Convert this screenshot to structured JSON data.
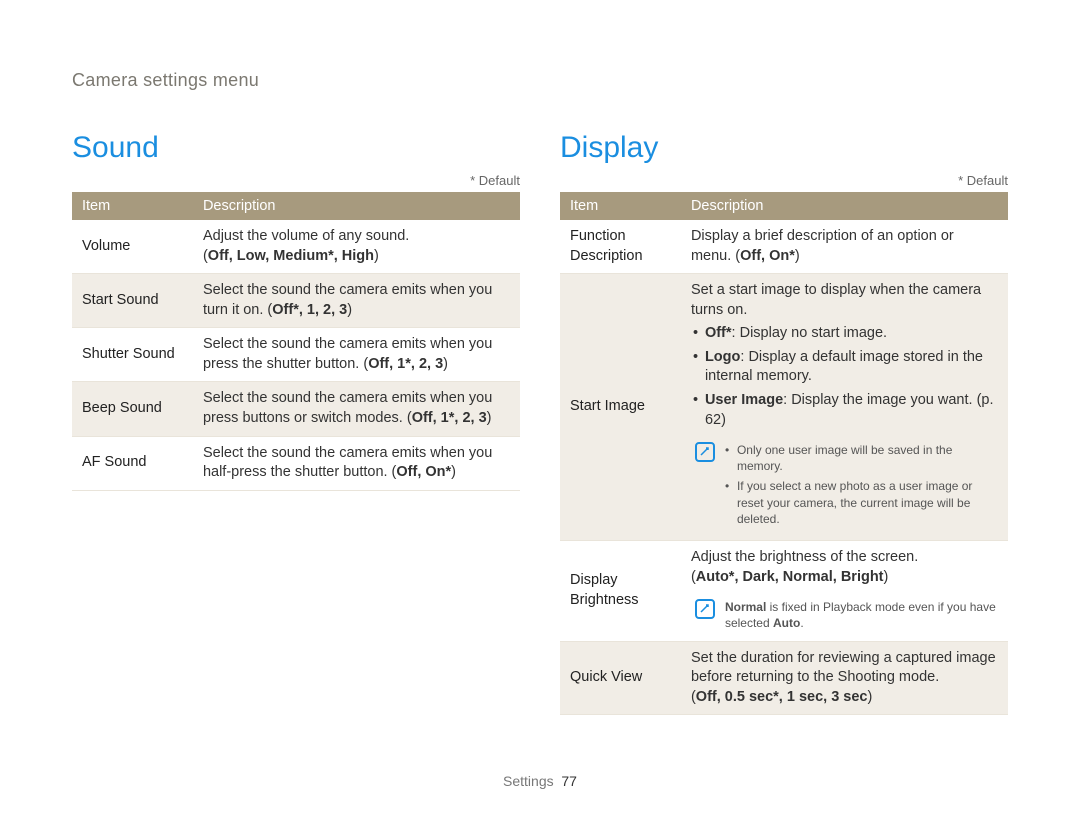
{
  "breadcrumb": "Camera settings menu",
  "default_label": "* Default",
  "footer": {
    "section": "Settings",
    "page": "77"
  },
  "left": {
    "title": "Sound",
    "headers": {
      "item": "Item",
      "desc": "Description"
    },
    "rows": [
      {
        "item": "Volume",
        "desc_pre": "Adjust the volume of any sound. ",
        "opts_open": "(",
        "opts": "Off, Low, Medium*, High",
        "opts_close": ")"
      },
      {
        "item": "Start Sound",
        "desc_pre": "Select the sound the camera emits when you turn it on. (",
        "opts": "Off*, 1, 2, 3",
        "opts_close": ")"
      },
      {
        "item": "Shutter Sound",
        "desc_pre": "Select the sound the camera emits when you press the shutter button. (",
        "opts": "Off, 1*, 2, 3",
        "opts_close": ")"
      },
      {
        "item": "Beep Sound",
        "desc_pre": "Select the sound the camera emits when you press buttons or switch modes. (",
        "opts": "Off, 1*, 2, 3",
        "opts_close": ")"
      },
      {
        "item": "AF Sound",
        "desc_pre": "Select the sound the camera emits when you half-press the shutter button. (",
        "opts": "Off, On*",
        "opts_close": ")"
      }
    ]
  },
  "right": {
    "title": "Display",
    "headers": {
      "item": "Item",
      "desc": "Description"
    },
    "rows": {
      "func_desc": {
        "item": "Function Description",
        "desc_pre": "Display a brief description of an option or menu. (",
        "opts": "Off, On*",
        "opts_close": ")"
      },
      "start_image": {
        "item": "Start Image",
        "intro": "Set a start image to display when the camera turns on.",
        "bullets": [
          {
            "label": "Off*",
            "text": ": Display no start image."
          },
          {
            "label": "Logo",
            "text": ": Display a default image stored in the internal memory."
          },
          {
            "label": "User Image",
            "text": ": Display the image you want. (p. 62)"
          }
        ],
        "notes": [
          "Only one user image will be saved in the memory.",
          "If you select a new photo as a user image or reset your camera, the current image will be deleted."
        ]
      },
      "brightness": {
        "item": "Display Brightness",
        "desc_pre": "Adjust the brightness of the screen. ",
        "opts_open": "(",
        "opts": "Auto*, Dark, Normal, Bright",
        "opts_close": ")",
        "note_pre": "",
        "note_bold1": "Normal",
        "note_mid": " is fixed in Playback mode even if you have selected ",
        "note_bold2": "Auto",
        "note_after": "."
      },
      "quick_view": {
        "item": "Quick View",
        "desc_pre": "Set the duration for reviewing a captured image before returning to the Shooting mode. ",
        "opts_open": "(",
        "opts": "Off, 0.5 sec*, 1 sec, 3 sec",
        "opts_close": ")"
      }
    }
  }
}
